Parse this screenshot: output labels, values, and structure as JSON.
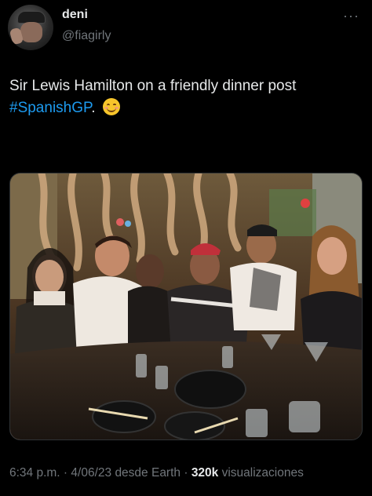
{
  "author": {
    "display_name": "deni",
    "handle": "@fiagirly"
  },
  "tweet": {
    "text_main": "Sir Lewis Hamilton on a friendly dinner post",
    "hashtag": "#SpanishGP",
    "text_after": "."
  },
  "meta": {
    "time": "6:34 p.m.",
    "sep1": " · ",
    "date": "4/06/23",
    "source": "desde Earth",
    "sep2": " · ",
    "views": "320k",
    "views_label": "visualizaciones"
  },
  "icons": {
    "more": "more-options-icon",
    "emoji": "smiling-face-emoji-icon"
  },
  "colors": {
    "background": "#000000",
    "text": "#e7e9ea",
    "secondary": "#71767b",
    "link": "#1d9bf0"
  }
}
